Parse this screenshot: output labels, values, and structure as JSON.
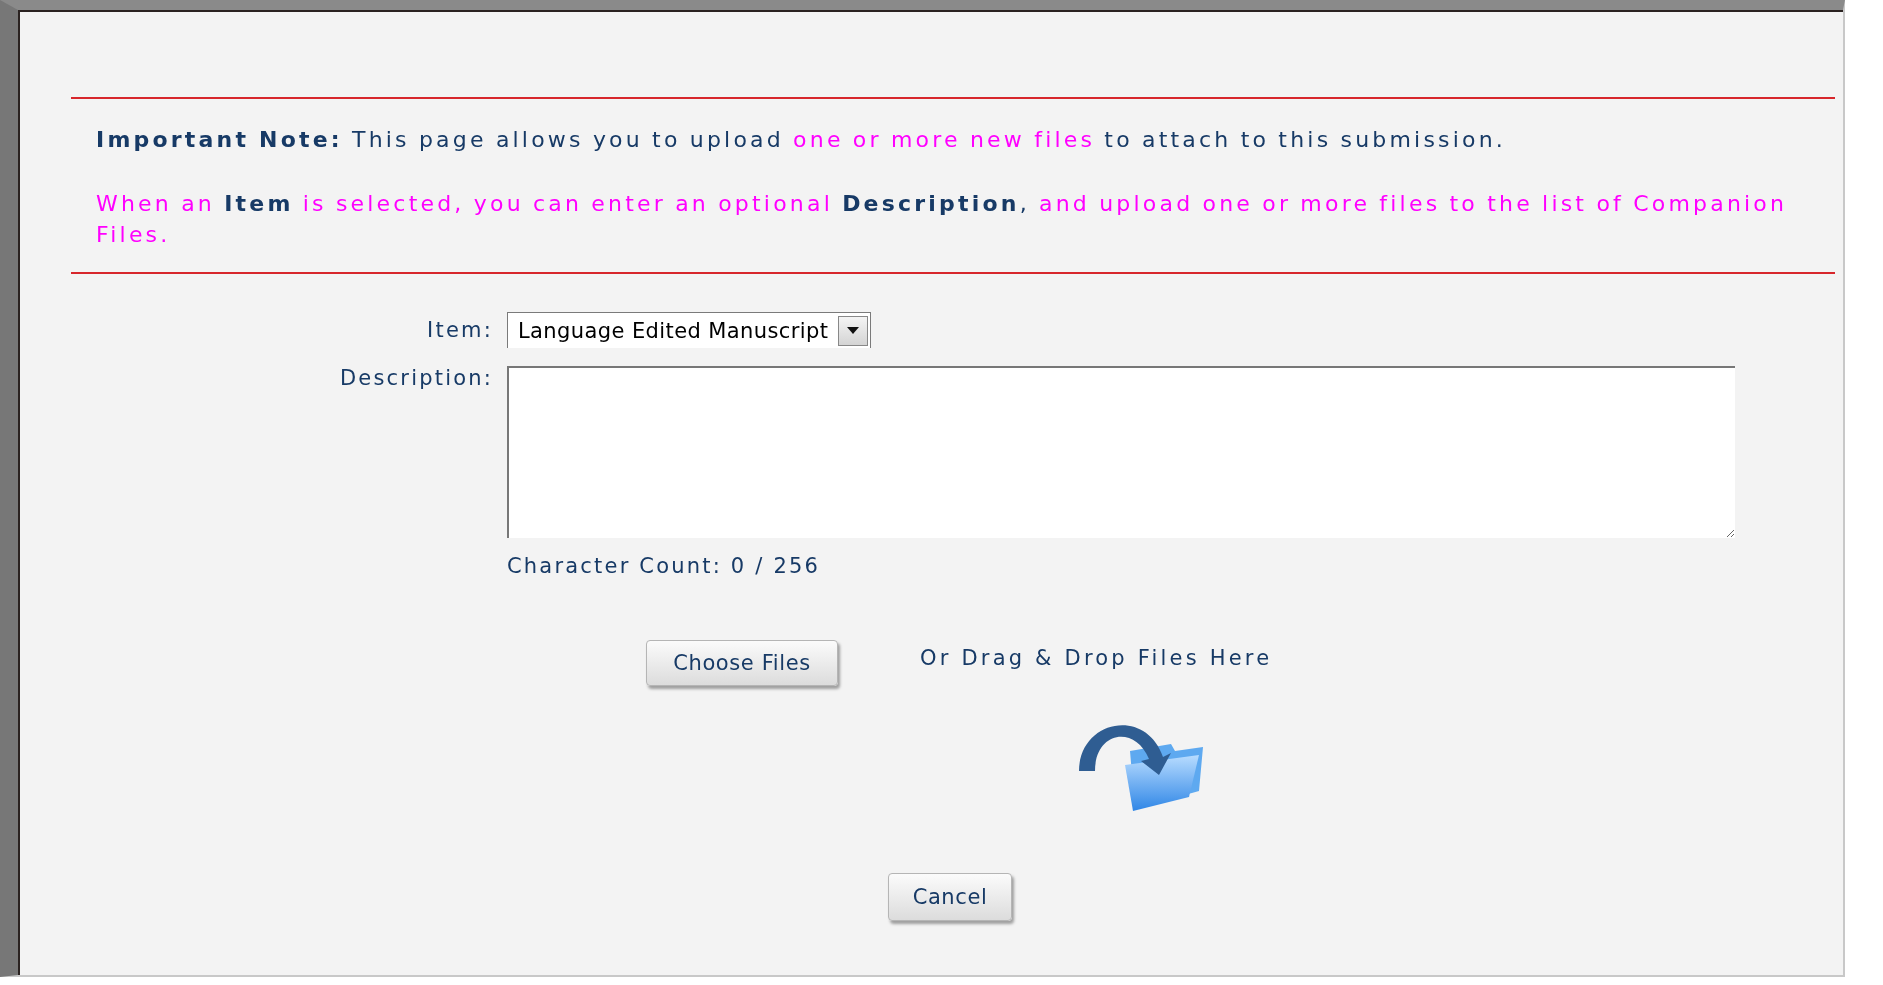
{
  "note": {
    "paragraphs": [
      {
        "segments": [
          {
            "text": "Important Note:",
            "kind": "strong"
          },
          {
            "text": " This page allows you to upload ",
            "kind": "plain"
          },
          {
            "text": "one or more new files",
            "kind": "highlight"
          },
          {
            "text": " to attach to this submission.",
            "kind": "plain"
          }
        ]
      },
      {
        "segments": [
          {
            "text": "When an ",
            "kind": "highlight"
          },
          {
            "text": "Item",
            "kind": "strong"
          },
          {
            "text": " is selected, you can enter an optional ",
            "kind": "highlight"
          },
          {
            "text": "Description",
            "kind": "strong"
          },
          {
            "text": ", ",
            "kind": "plain"
          },
          {
            "text": "and upload one or more files to the list of Companion Files.",
            "kind": "highlight"
          }
        ]
      }
    ]
  },
  "form": {
    "item": {
      "label": "Item:",
      "value": "Language Edited Manuscript"
    },
    "description": {
      "label": "Description:"
    },
    "character_count": "Character Count: 0 / 256"
  },
  "upload": {
    "button": "Choose Files",
    "drop_hint": "Or Drag & Drop Files Here"
  },
  "buttons": [
    "Cancel"
  ]
}
